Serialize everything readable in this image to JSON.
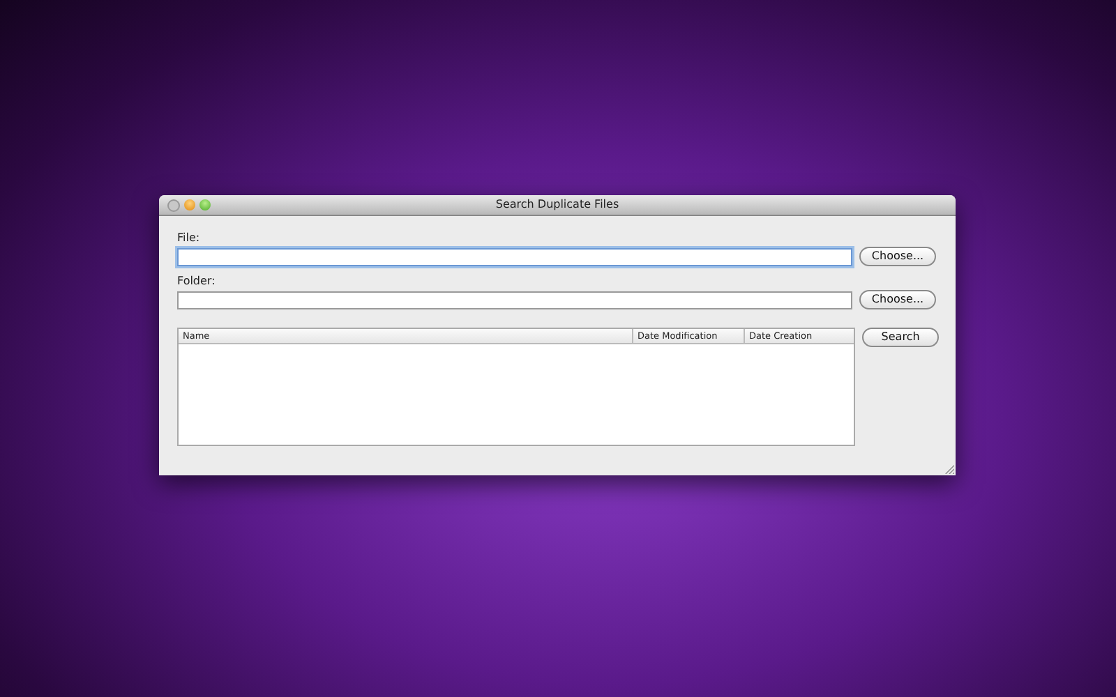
{
  "window": {
    "title": "Search Duplicate Files"
  },
  "fields": [
    {
      "label": "File:",
      "focused": true,
      "button": "Choose..."
    },
    {
      "label": "Folder:",
      "focused": false,
      "button": "Choose..."
    }
  ],
  "table": {
    "columns": [
      "Name",
      "Date Modification",
      "Date Creation"
    ]
  },
  "search_button": "Search"
}
